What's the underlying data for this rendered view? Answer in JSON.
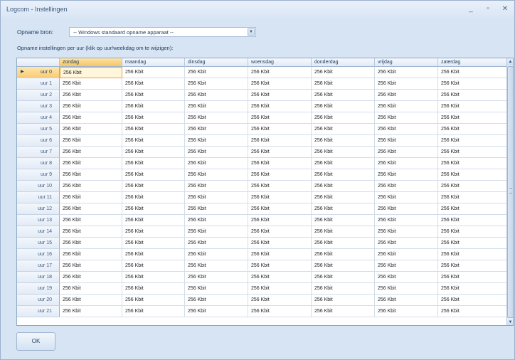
{
  "window": {
    "title": "Logcom - Instellingen",
    "controls": {
      "minimize": "_",
      "maximize": "▫",
      "close": "✕"
    }
  },
  "source": {
    "label": "Opname bron:",
    "value": "-- Windows standaard opname apparaat --"
  },
  "grid": {
    "caption": "Opname instellingen per uur (klik op uur/weekdag om te wijzigen):",
    "columns": [
      "zondag",
      "maandag",
      "dinsdag",
      "woensdag",
      "donderdag",
      "vrijdag",
      "zaterdag"
    ],
    "rows": [
      {
        "label": "uur 0",
        "cells": [
          "256 Kbit",
          "256 Kbit",
          "256 Kbit",
          "256 Kbit",
          "256 Kbit",
          "256 Kbit",
          "256 Kbit"
        ]
      },
      {
        "label": "uur 1",
        "cells": [
          "256 Kbit",
          "256 Kbit",
          "256 Kbit",
          "256 Kbit",
          "256 Kbit",
          "256 Kbit",
          "256 Kbit"
        ]
      },
      {
        "label": "uur 2",
        "cells": [
          "256 Kbit",
          "256 Kbit",
          "256 Kbit",
          "256 Kbit",
          "256 Kbit",
          "256 Kbit",
          "256 Kbit"
        ]
      },
      {
        "label": "uur 3",
        "cells": [
          "256 Kbit",
          "256 Kbit",
          "256 Kbit",
          "256 Kbit",
          "256 Kbit",
          "256 Kbit",
          "256 Kbit"
        ]
      },
      {
        "label": "uur 4",
        "cells": [
          "256 Kbit",
          "256 Kbit",
          "256 Kbit",
          "256 Kbit",
          "256 Kbit",
          "256 Kbit",
          "256 Kbit"
        ]
      },
      {
        "label": "uur 5",
        "cells": [
          "256 Kbit",
          "256 Kbit",
          "256 Kbit",
          "256 Kbit",
          "256 Kbit",
          "256 Kbit",
          "256 Kbit"
        ]
      },
      {
        "label": "uur 6",
        "cells": [
          "256 Kbit",
          "256 Kbit",
          "256 Kbit",
          "256 Kbit",
          "256 Kbit",
          "256 Kbit",
          "256 Kbit"
        ]
      },
      {
        "label": "uur 7",
        "cells": [
          "256 Kbit",
          "256 Kbit",
          "256 Kbit",
          "256 Kbit",
          "256 Kbit",
          "256 Kbit",
          "256 Kbit"
        ]
      },
      {
        "label": "uur 8",
        "cells": [
          "256 Kbit",
          "256 Kbit",
          "256 Kbit",
          "256 Kbit",
          "256 Kbit",
          "256 Kbit",
          "256 Kbit"
        ]
      },
      {
        "label": "uur 9",
        "cells": [
          "256 Kbit",
          "256 Kbit",
          "256 Kbit",
          "256 Kbit",
          "256 Kbit",
          "256 Kbit",
          "256 Kbit"
        ]
      },
      {
        "label": "uur 10",
        "cells": [
          "256 Kbit",
          "256 Kbit",
          "256 Kbit",
          "256 Kbit",
          "256 Kbit",
          "256 Kbit",
          "256 Kbit"
        ]
      },
      {
        "label": "uur 11",
        "cells": [
          "256 Kbit",
          "256 Kbit",
          "256 Kbit",
          "256 Kbit",
          "256 Kbit",
          "256 Kbit",
          "256 Kbit"
        ]
      },
      {
        "label": "uur 12",
        "cells": [
          "256 Kbit",
          "256 Kbit",
          "256 Kbit",
          "256 Kbit",
          "256 Kbit",
          "256 Kbit",
          "256 Kbit"
        ]
      },
      {
        "label": "uur 13",
        "cells": [
          "256 Kbit",
          "256 Kbit",
          "256 Kbit",
          "256 Kbit",
          "256 Kbit",
          "256 Kbit",
          "256 Kbit"
        ]
      },
      {
        "label": "uur 14",
        "cells": [
          "256 Kbit",
          "256 Kbit",
          "256 Kbit",
          "256 Kbit",
          "256 Kbit",
          "256 Kbit",
          "256 Kbit"
        ]
      },
      {
        "label": "uur 15",
        "cells": [
          "256 Kbit",
          "256 Kbit",
          "256 Kbit",
          "256 Kbit",
          "256 Kbit",
          "256 Kbit",
          "256 Kbit"
        ]
      },
      {
        "label": "uur 16",
        "cells": [
          "256 Kbit",
          "256 Kbit",
          "256 Kbit",
          "256 Kbit",
          "256 Kbit",
          "256 Kbit",
          "256 Kbit"
        ]
      },
      {
        "label": "uur 17",
        "cells": [
          "256 Kbit",
          "256 Kbit",
          "256 Kbit",
          "256 Kbit",
          "256 Kbit",
          "256 Kbit",
          "256 Kbit"
        ]
      },
      {
        "label": "uur 18",
        "cells": [
          "256 Kbit",
          "256 Kbit",
          "256 Kbit",
          "256 Kbit",
          "256 Kbit",
          "256 Kbit",
          "256 Kbit"
        ]
      },
      {
        "label": "uur 19",
        "cells": [
          "256 Kbit",
          "256 Kbit",
          "256 Kbit",
          "256 Kbit",
          "256 Kbit",
          "256 Kbit",
          "256 Kbit"
        ]
      },
      {
        "label": "uur 20",
        "cells": [
          "256 Kbit",
          "256 Kbit",
          "256 Kbit",
          "256 Kbit",
          "256 Kbit",
          "256 Kbit",
          "256 Kbit"
        ]
      },
      {
        "label": "uur 21",
        "cells": [
          "256 Kbit",
          "256 Kbit",
          "256 Kbit",
          "256 Kbit",
          "256 Kbit",
          "256 Kbit",
          "256 Kbit"
        ]
      }
    ]
  },
  "ok_label": "OK",
  "colors": {
    "selection": "#f7c45e",
    "frame": "#d7e4f4",
    "text": "#1e395b"
  }
}
